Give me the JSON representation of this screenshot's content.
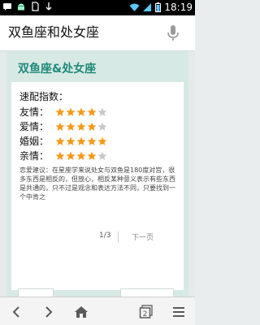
{
  "status_bar": {
    "time": "18:19",
    "left_icons": [
      "sms-icon",
      "android-icon",
      "sim-icon",
      "usb-icon"
    ],
    "right_icons": [
      "wifi-icon",
      "signal-icon",
      "battery-icon"
    ]
  },
  "search": {
    "query": "双鱼座和处女座",
    "icon": "mic-icon"
  },
  "card": {
    "title": "双鱼座&处女座",
    "match_heading": "速配指数：",
    "ratings": [
      {
        "label": "友情：",
        "filled": 4,
        "total": 5
      },
      {
        "label": "爱情：",
        "filled": 4,
        "total": 5
      },
      {
        "label": "婚姻：",
        "filled": 5,
        "total": 5
      },
      {
        "label": "亲情：",
        "filled": 4,
        "total": 5
      }
    ],
    "advice": "恋爱建议：在星座学来说处女与双鱼是180度对宫，很多东西是相反的，但放心，相反某种意义表示有些东西是共通的，只不过是观念和表达方法不同，只要找到一个中肯之",
    "pager": {
      "indicator": "1/3",
      "next": "下一页"
    }
  },
  "toolbar": {
    "buttons": [
      "back-icon",
      "forward-icon",
      "home-icon",
      "tabs-icon",
      "menu-icon"
    ],
    "tab_count": "2"
  },
  "colors": {
    "accent": "#1f8a76",
    "star_filled": "#f59a1b",
    "star_empty": "#c8c8c8",
    "card_bg": "#d7e9e5"
  }
}
